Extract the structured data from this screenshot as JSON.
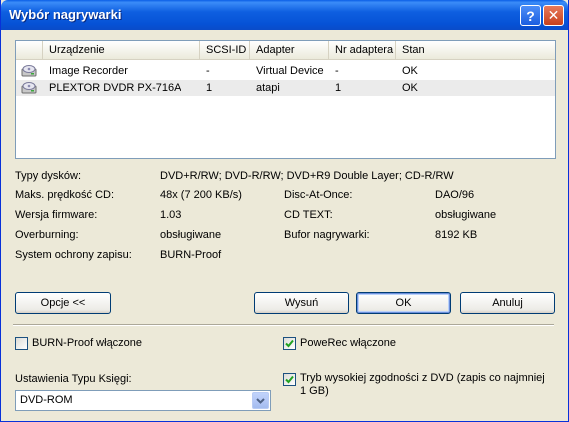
{
  "window": {
    "title": "Wybór nagrywarki",
    "help_glyph": "?",
    "close_glyph": "✕"
  },
  "devices": {
    "columns": [
      "Urządzenie",
      "SCSI-ID",
      "Adapter",
      "Nr adaptera",
      "Stan"
    ],
    "rows": [
      {
        "name": "Image Recorder",
        "scsi_id": "-",
        "adapter": "Virtual Device",
        "adapter_no": "-",
        "status": "OK"
      },
      {
        "name": "PLEXTOR  DVDR   PX-716A",
        "scsi_id": "1",
        "adapter": "atapi",
        "adapter_no": "1",
        "status": "OK"
      }
    ]
  },
  "info": {
    "disc_types": {
      "label": "Typy dysków:",
      "value": "DVD+R/RW; DVD-R/RW; DVD+R9 Double Layer; CD-R/RW"
    },
    "max_speed": {
      "label": "Maks. prędkość CD:",
      "value": "48x (7 200 KB/s)"
    },
    "dao": {
      "label": "Disc-At-Once:",
      "value": "DAO/96"
    },
    "firmware": {
      "label": "Wersja firmware:",
      "value": "1.03"
    },
    "cd_text": {
      "label": "CD TEXT:",
      "value": "obsługiwane"
    },
    "overburning": {
      "label": "Overburning:",
      "value": "obsługiwane"
    },
    "buffer": {
      "label": "Bufor nagrywarki:",
      "value": "8192 KB"
    },
    "protection": {
      "label": "System ochrony zapisu:",
      "value": "BURN-Proof"
    }
  },
  "buttons": {
    "options": "Opcje <<",
    "eject": "Wysuń",
    "ok": "OK",
    "cancel": "Anuluj"
  },
  "options": {
    "burnproof": {
      "label": "BURN-Proof włączone",
      "checked": false
    },
    "powerec": {
      "label": "PoweRec włączone",
      "checked": true
    },
    "high_compat": {
      "label": "Tryb wysokiej zgodności z DVD (zapis co najmniej 1 GB)",
      "checked": true
    },
    "booktype": {
      "label": "Ustawienia Typu Księgi:",
      "value": "DVD-ROM"
    }
  },
  "colors": {
    "titlebar": "#0a5ee6",
    "window_bg": "#ece9d8",
    "check_green": "#21a121"
  }
}
